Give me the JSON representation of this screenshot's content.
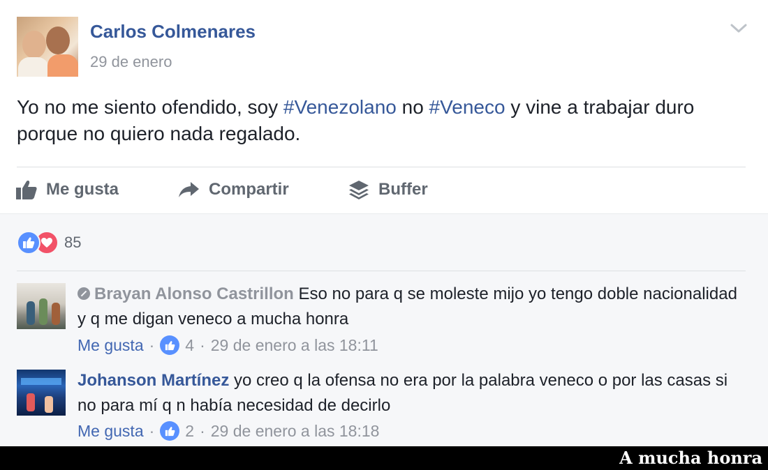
{
  "post": {
    "author": "Carlos Colmenares",
    "date": "29 de enero",
    "text_1": "Yo no me siento ofendido, soy ",
    "hashtag_1": "#Venezolano",
    "text_2": " no ",
    "hashtag_2": "#Veneco",
    "text_3": " y vine a trabajar duro porque no quiero nada regalado.",
    "menu_icon": "chevron-down-icon"
  },
  "actions": {
    "like_label": "Me gusta",
    "share_label": "Compartir",
    "buffer_label": "Buffer"
  },
  "reactions": {
    "count": "85",
    "types": [
      "like",
      "love"
    ]
  },
  "comments": [
    {
      "name": "Brayan Alonso Castrillon",
      "text": "Eso no para q se moleste mijo yo tengo doble nacionalidad y q me digan veneco a mucha honra",
      "like_label": "Me gusta",
      "separator": "·",
      "likes": "4",
      "timestamp": "29 de enero a las 18:11"
    },
    {
      "name": "Johanson Martínez",
      "text": "yo creo q la ofensa no era por la palabra veneco o por las casas si no para mí q n había necesidad de decirlo",
      "like_label": "Me gusta",
      "separator": "·",
      "likes": "2",
      "timestamp": "29 de enero a las 18:18"
    }
  ],
  "caption": "A mucha honra",
  "colors": {
    "link_blue": "#365899",
    "like_blue": "#5890ff",
    "love_red": "#f25268",
    "muted_gray": "#90949c",
    "caption_bg": "#000000"
  }
}
